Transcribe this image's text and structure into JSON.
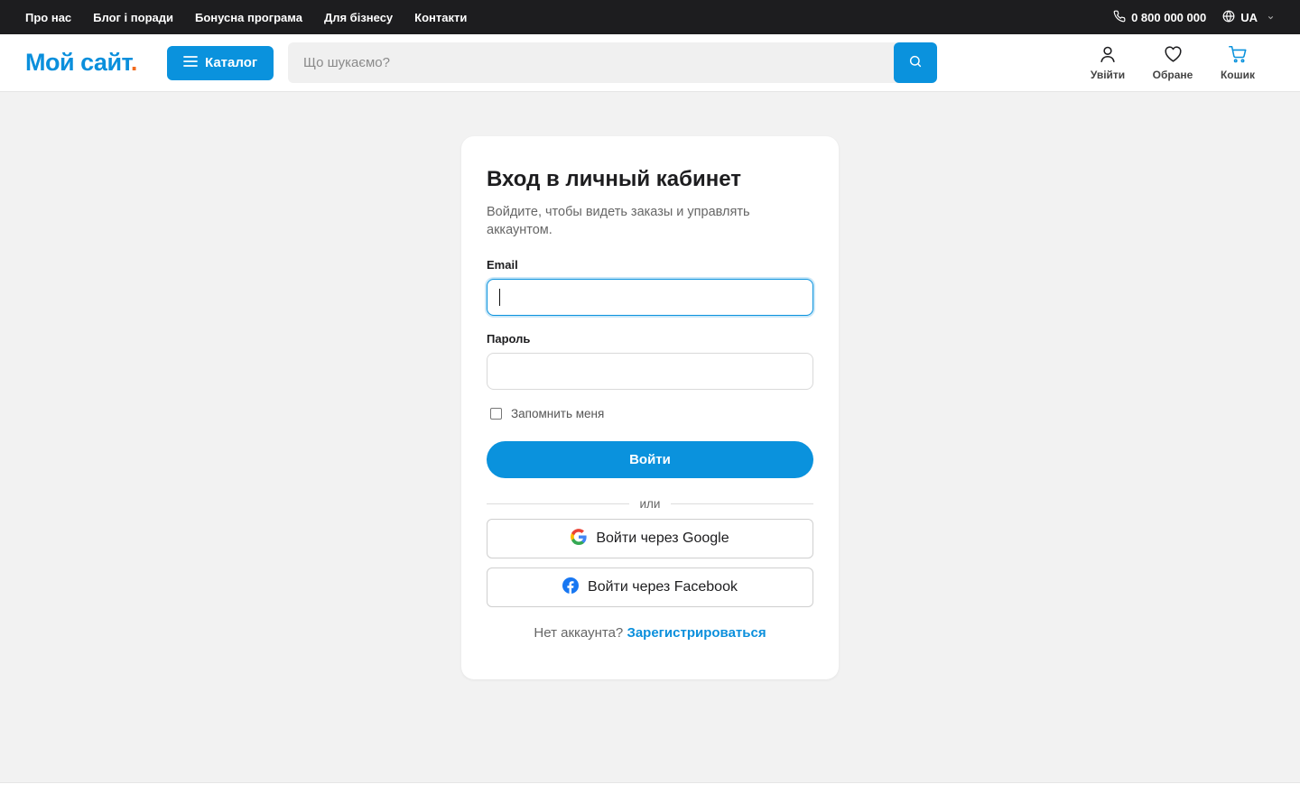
{
  "topbar": {
    "nav": [
      "Про нас",
      "Блог і поради",
      "Бонусна програма",
      "Для бізнесу",
      "Контакти"
    ],
    "phone": "0 800 000 000",
    "language": "UA"
  },
  "header": {
    "logo_text": "Мой сайт",
    "logo_dot": ".",
    "catalog_label": "Каталог",
    "search_placeholder": "Що шукаємо?",
    "actions": {
      "login": "Увійти",
      "favorites": "Обране",
      "cart": "Кошик"
    }
  },
  "login_form": {
    "title": "Вход в личный кабинет",
    "subtitle": "Войдите, чтобы видеть заказы и управлять аккаунтом.",
    "email_label": "Email",
    "email_value": "",
    "password_label": "Пароль",
    "password_value": "",
    "remember_label": "Запомнить меня",
    "remember_checked": false,
    "submit_label": "Войти",
    "divider_text": "или",
    "google_label": "Войти через Google",
    "facebook_label": "Войти через Facebook",
    "register_prompt": "Нет аккаунта?",
    "register_link": "Зарегистрироваться"
  },
  "colors": {
    "accent": "#0a92dd",
    "logo_dot": "#f26b1d",
    "topbar_bg": "#1d1d1f",
    "page_bg": "#f2f2f2"
  },
  "icons": {
    "phone": "phone-icon",
    "language": "globe-icon",
    "catalog": "menu-icon",
    "search": "search-icon",
    "login": "user-icon",
    "favorites": "heart-icon",
    "cart": "cart-icon",
    "google": "google-icon",
    "facebook": "facebook-icon"
  }
}
